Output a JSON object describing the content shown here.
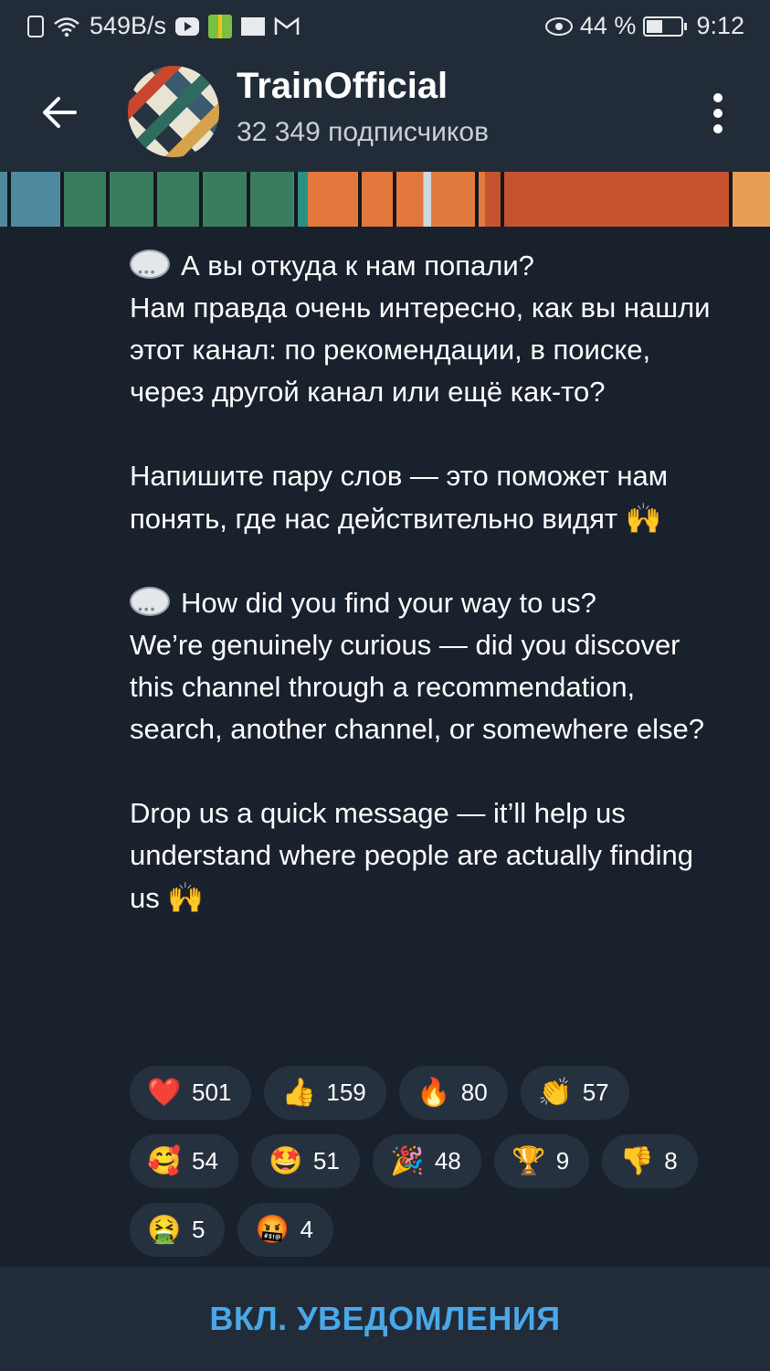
{
  "status_bar": {
    "speed": "549B/s",
    "battery_percent": "44 %",
    "time": "9:12"
  },
  "header": {
    "title": "TrainOfficial",
    "subscribers": "32 349 подписчиков"
  },
  "message": {
    "ru_question": "А вы откуда к нам попали?",
    "ru_body": "Нам правда очень интересно, как вы нашли этот канал: по рекомендации, в поиске, через другой канал или ещё как-то?",
    "ru_cta": "Напишите пару слов — это поможет нам понять, где нас действительно видят",
    "en_question": "How did you find your way to us?",
    "en_body": "We’re genuinely curious — did you discover this channel through a recommendation, search, another channel, or somewhere else?",
    "en_cta": "Drop us a quick message — it’ll help us understand where people are actually finding us",
    "hands_emoji": "🙌"
  },
  "reactions": [
    {
      "emoji": "❤️",
      "count": "501"
    },
    {
      "emoji": "👍",
      "count": "159"
    },
    {
      "emoji": "🔥",
      "count": "80"
    },
    {
      "emoji": "👏",
      "count": "57"
    },
    {
      "emoji": "🥰",
      "count": "54"
    },
    {
      "emoji": "🤩",
      "count": "51"
    },
    {
      "emoji": "🎉",
      "count": "48"
    },
    {
      "emoji": "🏆",
      "count": "9"
    },
    {
      "emoji": "👎",
      "count": "8"
    },
    {
      "emoji": "🤮",
      "count": "5"
    },
    {
      "emoji": "🤬",
      "count": "4"
    }
  ],
  "bottom": {
    "notify_label": "ВКЛ. УВЕДОМЛЕНИЯ"
  },
  "colors": {
    "background": "#19212d",
    "bar": "#222c38",
    "reaction_bg": "#263140",
    "accent": "#4aa8e8"
  }
}
